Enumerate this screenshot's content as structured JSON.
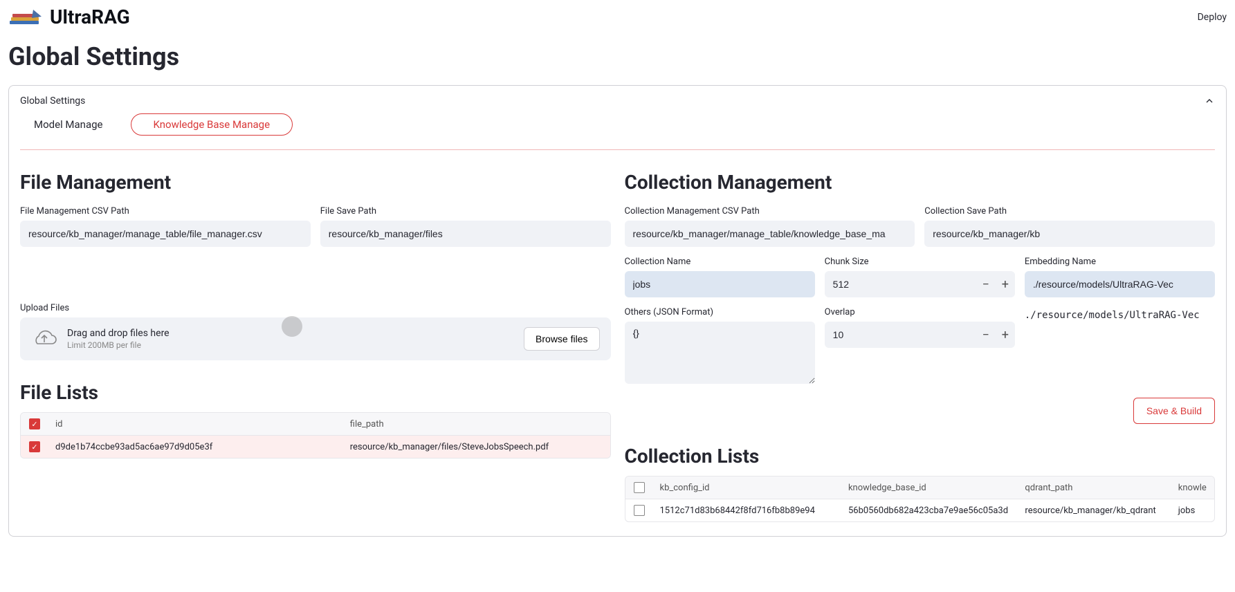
{
  "header": {
    "brand": "UltraRAG",
    "deploy": "Deploy"
  },
  "page": {
    "title": "Global Settings",
    "expander_label": "Global Settings"
  },
  "tabs": {
    "model_manage": "Model Manage",
    "kb_manage": "Knowledge Base Manage"
  },
  "file_mgmt": {
    "heading": "File Management",
    "csv_path_label": "File Management CSV Path",
    "csv_path_value": "resource/kb_manager/manage_table/file_manager.csv",
    "save_path_label": "File Save Path",
    "save_path_value": "resource/kb_manager/files",
    "upload_label": "Upload Files",
    "drop_text": "Drag and drop files here",
    "drop_sub": "Limit 200MB per file",
    "browse_btn": "Browse files"
  },
  "collection_mgmt": {
    "heading": "Collection Management",
    "csv_path_label": "Collection Management CSV Path",
    "csv_path_value": "resource/kb_manager/manage_table/knowledge_base_ma",
    "save_path_label": "Collection Save Path",
    "save_path_value": "resource/kb_manager/kb",
    "collection_name_label": "Collection Name",
    "collection_name_value": "jobs",
    "chunk_size_label": "Chunk Size",
    "chunk_size_value": "512",
    "embedding_name_label": "Embedding Name",
    "embedding_name_value": "./resource/models/UltraRAG-Vec",
    "others_label": "Others (JSON Format)",
    "others_value": "{}",
    "overlap_label": "Overlap",
    "overlap_value": "10",
    "embedding_path_display": "./resource/models/UltraRAG-Vec",
    "save_build_btn": "Save & Build"
  },
  "file_lists": {
    "heading": "File Lists",
    "columns": {
      "id": "id",
      "file_path": "file_path"
    },
    "rows": [
      {
        "checked": true,
        "id": "d9de1b74ccbe93ad5ac6ae97d9d05e3f",
        "file_path": "resource/kb_manager/files/SteveJobsSpeech.pdf"
      }
    ]
  },
  "collection_lists": {
    "heading": "Collection Lists",
    "columns": {
      "kb_config_id": "kb_config_id",
      "knowledge_base_id": "knowledge_base_id",
      "qdrant_path": "qdrant_path",
      "knowledge": "knowle"
    },
    "rows": [
      {
        "checked": false,
        "kb_config_id": "1512c71d83b68442f8fd716fb8b89e94",
        "knowledge_base_id": "56b0560db682a423cba7e9ae56c05a3d",
        "qdrant_path": "resource/kb_manager/kb_qdrant",
        "knowledge": "jobs"
      }
    ]
  }
}
